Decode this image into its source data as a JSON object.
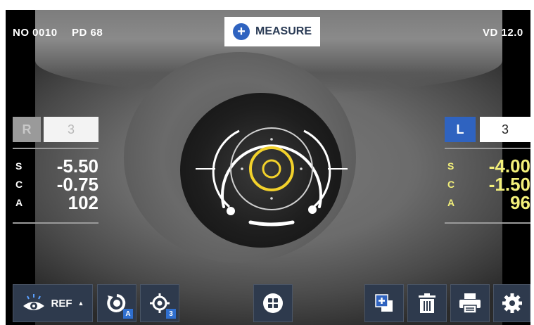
{
  "header": {
    "no_label": "NO",
    "no_value": "0010",
    "pd_label": "PD",
    "pd_value": "68",
    "vd_label": "VD",
    "vd_value": "12.0"
  },
  "measure_button": {
    "label": "MEASURE"
  },
  "right_eye": {
    "side_label": "R",
    "count": "3",
    "active": false,
    "rows": [
      {
        "label": "S",
        "value": "-5.50"
      },
      {
        "label": "C",
        "value": "-0.75"
      },
      {
        "label": "A",
        "value": "102"
      }
    ],
    "text_color": "#ffffff"
  },
  "left_eye": {
    "side_label": "L",
    "count": "3",
    "active": true,
    "rows": [
      {
        "label": "S",
        "value": "-4.00"
      },
      {
        "label": "C",
        "value": "-1.50"
      },
      {
        "label": "A",
        "value": "96"
      }
    ],
    "text_color": "#f3f07a"
  },
  "toolbar": {
    "ref_label": "REF",
    "auto_badge": "A",
    "target_badge": "3"
  },
  "colors": {
    "accent_blue": "#2f63c0",
    "reticle_yellow": "#f2d12b",
    "toolbar_bg": "#2e3a4d"
  }
}
